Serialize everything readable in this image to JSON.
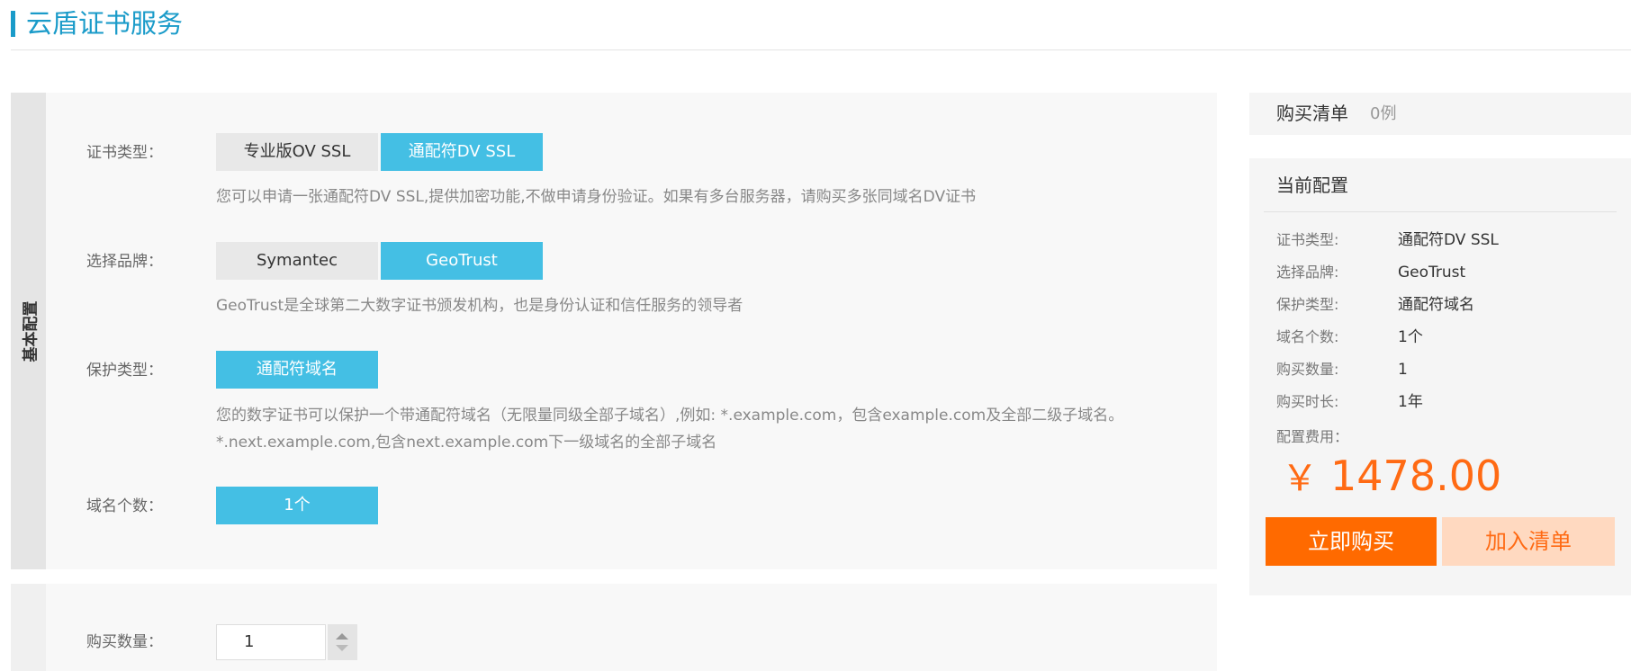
{
  "page": {
    "title": "云盾证书服务"
  },
  "basic_config": {
    "side_label": "基本配置",
    "cert_type": {
      "label": "证书类型：",
      "options": [
        "专业版OV SSL",
        "通配符DV SSL"
      ],
      "selected": "通配符DV SSL",
      "hint": "您可以申请一张通配符DV SSL,提供加密功能,不做申请身份验证。如果有多台服务器，请购买多张同域名DV证书"
    },
    "brand": {
      "label": "选择品牌：",
      "options": [
        "Symantec",
        "GeoTrust"
      ],
      "selected": "GeoTrust",
      "hint": "GeoTrust是全球第二大数字证书颁发机构，也是身份认证和信任服务的领导者"
    },
    "protect_type": {
      "label": "保护类型：",
      "options": [
        "通配符域名"
      ],
      "selected": "通配符域名",
      "hint_line1": "您的数字证书可以保护一个带通配符域名（无限量同级全部子域名）,例如: *.example.com，包含example.com及全部二级子域名。",
      "hint_line2": "*.next.example.com,包含next.example.com下一级域名的全部子域名"
    },
    "domain_count": {
      "label": "域名个数：",
      "options": [
        "1个"
      ],
      "selected": "1个"
    }
  },
  "purchase": {
    "qty_label": "购买数量：",
    "qty_value": "1"
  },
  "cart": {
    "title": "购买清单",
    "count": "0例"
  },
  "summary": {
    "title": "当前配置",
    "rows": [
      {
        "label": "证书类型:",
        "value": "通配符DV SSL"
      },
      {
        "label": "选择品牌:",
        "value": "GeoTrust"
      },
      {
        "label": "保护类型:",
        "value": "通配符域名"
      },
      {
        "label": "域名个数:",
        "value": "1个"
      },
      {
        "label": "购买数量:",
        "value": "1"
      },
      {
        "label": "购买时长:",
        "value": "1年"
      }
    ],
    "fee_label": "配置费用：",
    "currency": "￥",
    "price": "1478.00",
    "buy_label": "立即购买",
    "add_label": "加入清单"
  },
  "colors": {
    "accent": "#1a9bc9",
    "selected_option": "#44bfe4",
    "price": "#ff6a13",
    "buy_button": "#ff6a00",
    "add_button_bg": "#ffd9c0"
  }
}
